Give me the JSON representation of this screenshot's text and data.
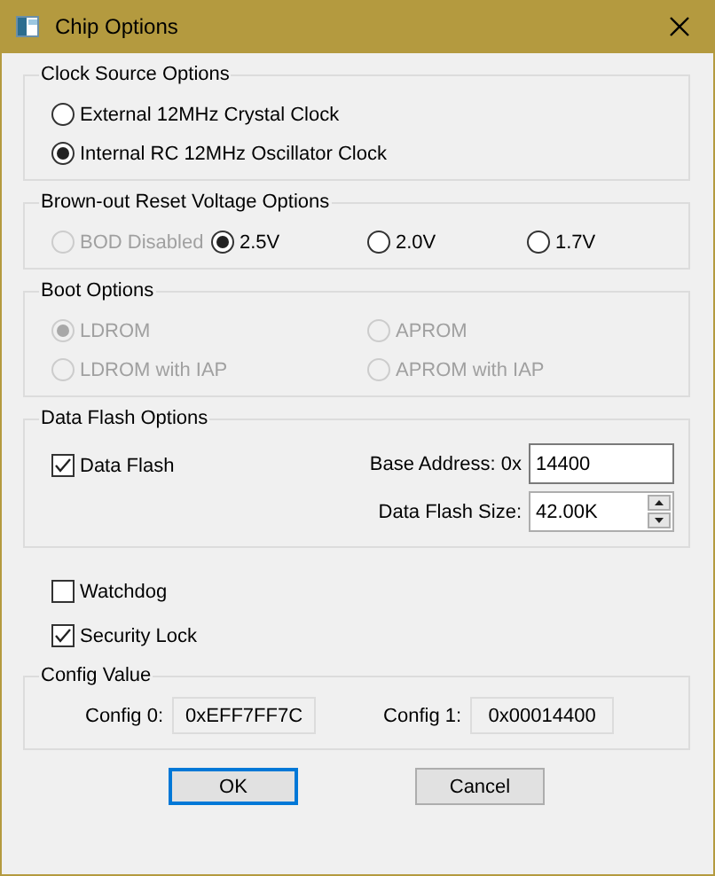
{
  "window": {
    "title": "Chip Options"
  },
  "clock_source": {
    "title": "Clock Source Options",
    "options": [
      {
        "label": "External 12MHz Crystal Clock",
        "selected": false,
        "disabled": false
      },
      {
        "label": "Internal RC 12MHz Oscillator Clock",
        "selected": true,
        "disabled": false
      }
    ]
  },
  "brown_out": {
    "title": "Brown-out Reset Voltage Options",
    "options": [
      {
        "label": "BOD Disabled",
        "selected": false,
        "disabled": true
      },
      {
        "label": "2.5V",
        "selected": true,
        "disabled": false
      },
      {
        "label": "2.0V",
        "selected": false,
        "disabled": false
      },
      {
        "label": "1.7V",
        "selected": false,
        "disabled": false
      }
    ]
  },
  "boot": {
    "title": "Boot Options",
    "options": [
      {
        "label": "LDROM",
        "selected": true,
        "disabled": true
      },
      {
        "label": "APROM",
        "selected": false,
        "disabled": true
      },
      {
        "label": "LDROM with IAP",
        "selected": false,
        "disabled": true
      },
      {
        "label": "APROM with IAP",
        "selected": false,
        "disabled": true
      }
    ]
  },
  "data_flash": {
    "title": "Data Flash Options",
    "checkbox": {
      "label": "Data Flash",
      "checked": true
    },
    "base_address": {
      "label": "Base Address: 0x",
      "value": "14400"
    },
    "size": {
      "label": "Data Flash Size:",
      "value": "42.00K"
    }
  },
  "checkboxes": [
    {
      "label": "Watchdog",
      "checked": false
    },
    {
      "label": "Security Lock",
      "checked": true
    }
  ],
  "config_value": {
    "title": "Config Value",
    "fields": [
      {
        "label": "Config 0:",
        "value": "0xEFF7FF7C"
      },
      {
        "label": "Config 1:",
        "value": "0x00014400"
      }
    ]
  },
  "buttons": [
    {
      "label": "OK",
      "default": true
    },
    {
      "label": "Cancel",
      "default": false
    }
  ]
}
